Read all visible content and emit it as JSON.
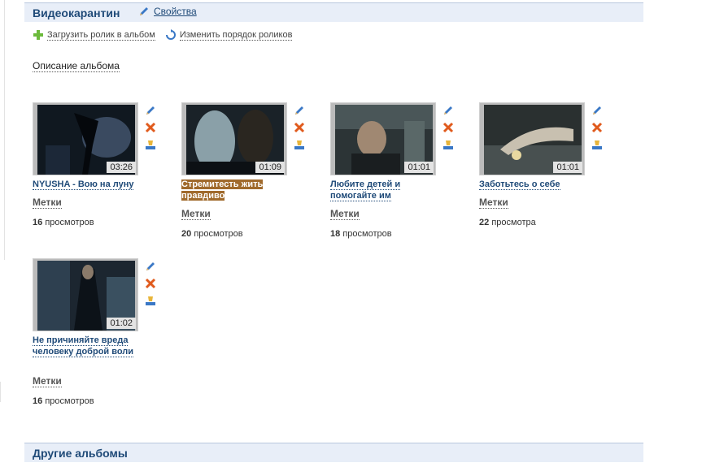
{
  "album": {
    "title": "Видеокарантин",
    "properties_label": "Свойства",
    "upload_label": "Загрузить ролик в альбом",
    "reorder_label": "Изменить порядок роликов",
    "description_label": "Описание альбома"
  },
  "videos": [
    {
      "title": "NYUSHA - Вою на луну",
      "duration": "03:26",
      "tags_label": "Метки",
      "views_count": "16",
      "views_label": "просмотров"
    },
    {
      "title": "Стремитесть жить правдиво",
      "duration": "01:09",
      "tags_label": "Метки",
      "views_count": "20",
      "views_label": "просмотров"
    },
    {
      "title": "Любите детей и помогайте им",
      "duration": "01:01",
      "tags_label": "Метки",
      "views_count": "18",
      "views_label": "просмотров"
    },
    {
      "title": "Заботьтесь о себе",
      "duration": "01:01",
      "tags_label": "Метки",
      "views_count": "22",
      "views_label": "просмотра"
    },
    {
      "title": "Не причиняйте вреда человеку доброй воли",
      "duration": "01:02",
      "tags_label": "Метки",
      "views_count": "16",
      "views_label": "просмотров"
    }
  ],
  "other_albums": {
    "title": "Другие альбомы"
  },
  "icons": {
    "edit": "pencil-icon",
    "delete": "delete-icon",
    "cover": "cover-icon",
    "add": "plus-icon",
    "reorder": "refresh-icon"
  }
}
